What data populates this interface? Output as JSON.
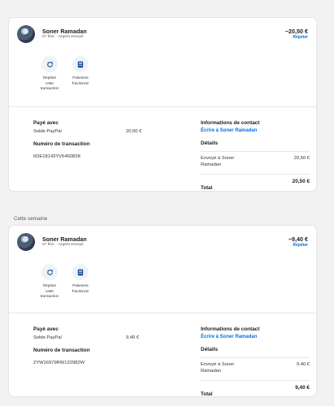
{
  "section_label": "Cette semaine",
  "transactions": [
    {
      "name": "Soner Ramadan",
      "subtitle": "27 févr. · Argent envoyé",
      "amount": "−20,50 €",
      "repeat_link": "Répéter",
      "actions": [
        {
          "label_lines": [
            "Répéter",
            "cette",
            "transaction"
          ],
          "icon": "refresh-icon"
        },
        {
          "label_lines": [
            "Paiement",
            "fractionné"
          ],
          "icon": "split-payment-icon"
        }
      ],
      "paid_with_title": "Payé avec",
      "paid_with_method": "Solde PayPal",
      "paid_with_amount": "20,50 €",
      "transaction_number_title": "Numéro de transaction",
      "transaction_number": "6DE18143YV546082K",
      "contact_title": "Informations de contact",
      "contact_link": "Écrire à Soner Ramadan",
      "details_title": "Détails",
      "details_label_lines": [
        "Envoyé à Soner",
        "Ramadan"
      ],
      "details_amount": "20,50 €",
      "total_label": "Total",
      "total_amount": "20,50 €"
    },
    {
      "name": "Soner Ramadan",
      "subtitle": "27 févr. · Argent envoyé",
      "amount": "−9,40 €",
      "repeat_link": "Répéter",
      "actions": [
        {
          "label_lines": [
            "Répéter",
            "cette",
            "transaction"
          ],
          "icon": "refresh-icon"
        },
        {
          "label_lines": [
            "Paiement",
            "fractionné"
          ],
          "icon": "split-payment-icon"
        }
      ],
      "paid_with_title": "Payé avec",
      "paid_with_method": "Solde PayPal",
      "paid_with_amount": "9,40 €",
      "transaction_number_title": "Numéro de transaction",
      "transaction_number": "2YW16979RW122982W",
      "contact_title": "Informations de contact",
      "contact_link": "Écrire à Soner Ramadan",
      "details_title": "Détails",
      "details_label_lines": [
        "Envoyé à Soner",
        "Ramadan"
      ],
      "details_amount": "9,40 €",
      "total_label": "Total",
      "total_amount": "9,40 €"
    }
  ],
  "colors": {
    "link": "#0070e0",
    "background": "#f2f2f2",
    "card": "#ffffff"
  }
}
